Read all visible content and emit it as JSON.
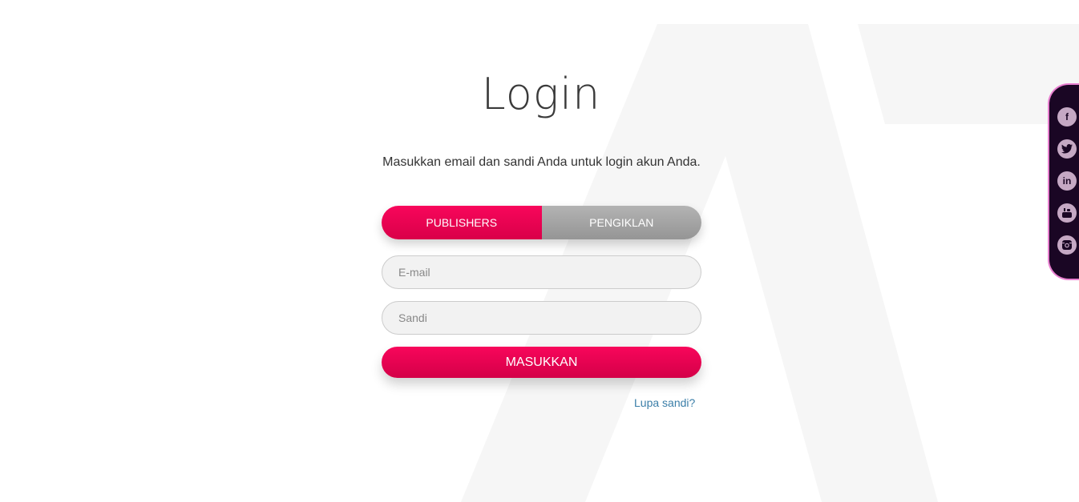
{
  "login": {
    "title": "Login",
    "subtitle": "Masukkan email dan sandi Anda untuk login akun Anda.",
    "tabs": [
      {
        "label": "PUBLISHERS",
        "active": true
      },
      {
        "label": "PENGIKLAN",
        "active": false
      }
    ],
    "email_placeholder": "E-mail",
    "password_placeholder": "Sandi",
    "submit_label": "MASUKKAN",
    "forgot_label": "Lupa sandi?"
  },
  "social": {
    "icons": [
      "facebook-icon",
      "twitter-icon",
      "linkedin-icon",
      "youtube-icon",
      "instagram-icon"
    ],
    "facebook_glyph": "f",
    "linkedin_glyph": "in"
  },
  "colors": {
    "accent": "#f20558",
    "inactive_tab": "#a6a6a6",
    "link": "#3a7ea8",
    "social_bar": "#1a0624",
    "social_border": "#e87fd0"
  }
}
